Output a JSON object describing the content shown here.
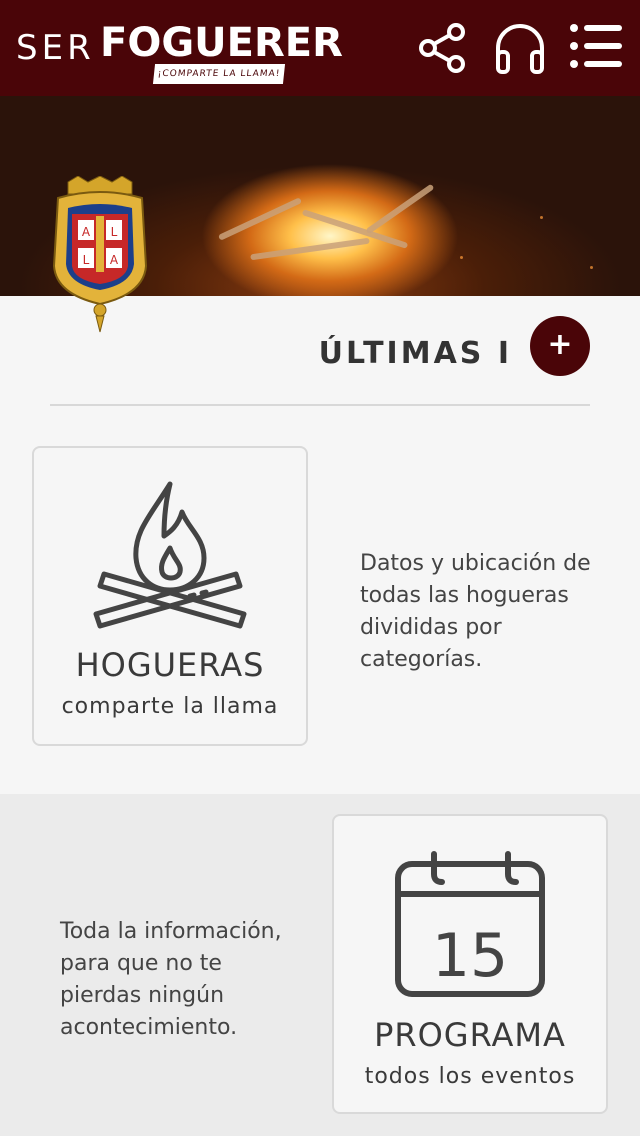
{
  "header": {
    "logo_prefix": "SER",
    "logo_main": "FOGUERER",
    "logo_tagline": "¡COMPARTE LA LLAMA!",
    "icons": [
      "share-icon",
      "headphones-icon",
      "menu-icon"
    ]
  },
  "latest": {
    "label": "ÚLTIMAS I",
    "plus_label": "+"
  },
  "cards": {
    "hogueras": {
      "title": "HOGUERAS",
      "subtitle": "comparte la llama",
      "description": "Datos y ubicación de todas las hogueras divididas por categorías."
    },
    "programa": {
      "title": "PROGRAMA",
      "subtitle": "todos los eventos",
      "calendar_day": "15",
      "description": "Toda la información, para que no te pierdas ningún acontecimiento."
    }
  },
  "colors": {
    "brand": "#4a0508",
    "background": "#f6f6f6",
    "section_alt": "#ebebeb"
  }
}
